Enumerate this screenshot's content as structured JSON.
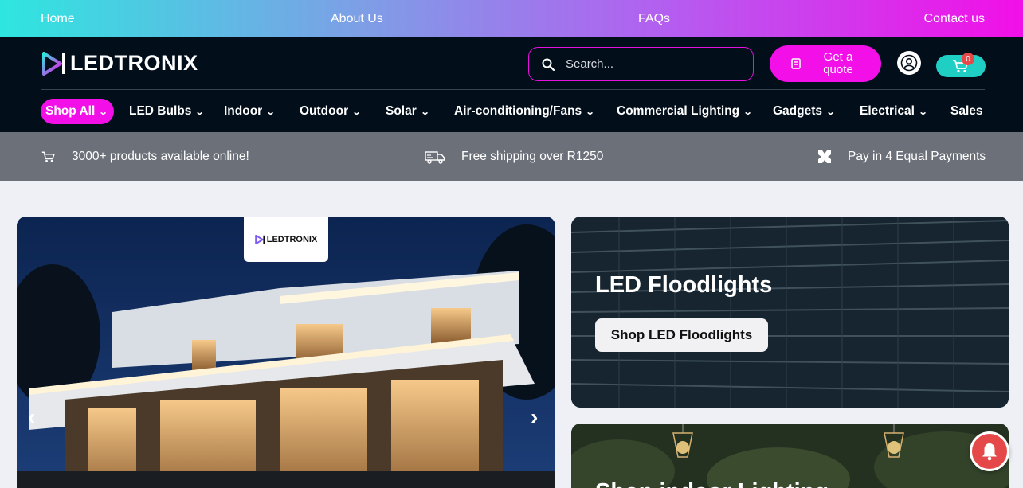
{
  "topbar": {
    "home": "Home",
    "about": "About Us",
    "faqs": "FAQs",
    "contact": "Contact us"
  },
  "header": {
    "logo_text": "LEDTRONIX",
    "search_placeholder": "Search...",
    "quote_label": "Get a quote",
    "cart_count": "0"
  },
  "nav": {
    "items": [
      {
        "label": "Shop All"
      },
      {
        "label": "LED Bulbs"
      },
      {
        "label": "Indoor"
      },
      {
        "label": "Outdoor"
      },
      {
        "label": "Solar"
      },
      {
        "label": "Air-conditioning/Fans"
      },
      {
        "label": "Commercial Lighting"
      },
      {
        "label": "Gadgets"
      },
      {
        "label": "Electrical"
      },
      {
        "label": "Sales"
      }
    ]
  },
  "info": {
    "products": "3000+ products available online!",
    "shipping": "Free shipping over R1250",
    "payments": "Pay in 4 Equal Payments"
  },
  "hero": {
    "logo_text": "LEDTRONIX"
  },
  "cards": {
    "flood_title": "LED Floodlights",
    "flood_button": "Shop LED Floodlights",
    "indoor_title": "Shop indoor Lighting"
  },
  "colors": {
    "accent": "#f20fe8",
    "teal": "#1fcfc3",
    "header_bg": "#020e1a",
    "info_bg": "#6b7079"
  }
}
